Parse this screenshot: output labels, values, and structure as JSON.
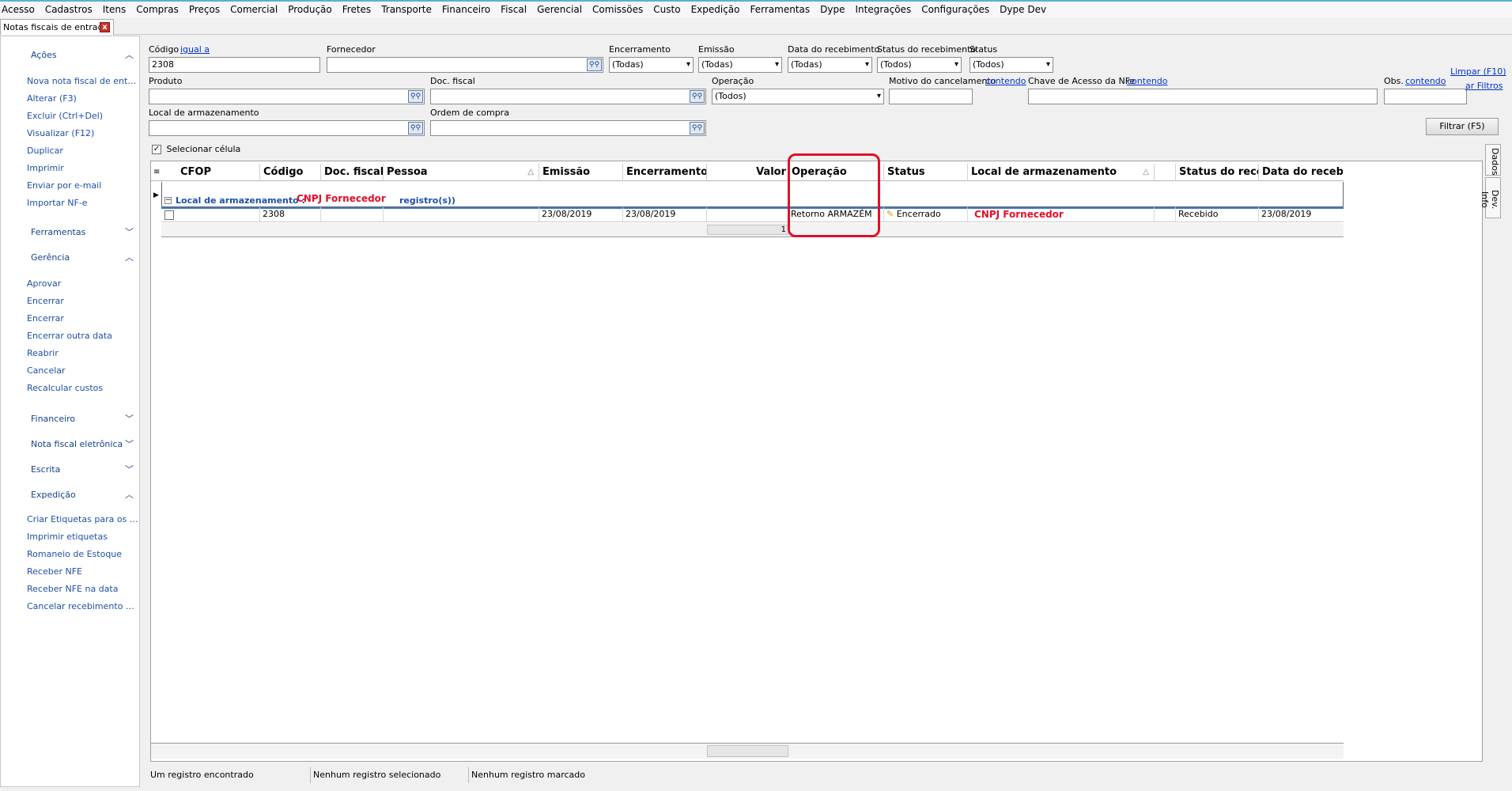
{
  "menu": [
    "Acesso",
    "Cadastros",
    "Itens",
    "Compras",
    "Preços",
    "Comercial",
    "Produção",
    "Fretes",
    "Transporte",
    "Financeiro",
    "Fiscal",
    "Gerencial",
    "Comissões",
    "Custo",
    "Expedição",
    "Ferramentas",
    "Dype",
    "Integrações",
    "Configurações",
    "Dype Dev"
  ],
  "doc_tab": {
    "label": "Notas fiscais de entrada",
    "close": "x"
  },
  "sidebar": {
    "acoes": {
      "title": "Ações",
      "items": [
        "Nova nota fiscal de entrada",
        "Alterar (F3)",
        "Excluir (Ctrl+Del)",
        "Visualizar (F12)",
        "Duplicar",
        "Imprimir",
        "Enviar por e-mail",
        "Importar NF-e"
      ]
    },
    "ferramentas": {
      "title": "Ferramentas"
    },
    "gerencia": {
      "title": "Gerência",
      "items": [
        "Aprovar",
        "Encerrar",
        "Encerrar",
        "Encerrar outra data",
        "Reabrir",
        "Cancelar",
        "Recalcular custos"
      ]
    },
    "financeiro": {
      "title": "Financeiro"
    },
    "nfe": {
      "title": "Nota fiscal eletrônica"
    },
    "escrita": {
      "title": "Escrita"
    },
    "expedicao": {
      "title": "Expedição",
      "items": [
        "Criar Etiquetas para os itens",
        "Imprimir etiquetas",
        "Romaneio de Estoque",
        "Receber NFE",
        "Receber NFE na data",
        "Cancelar recebimento NFE"
      ]
    }
  },
  "filters": {
    "codigo": {
      "label": "Código",
      "mode": "igual a",
      "value": "2308"
    },
    "fornecedor": {
      "label": "Fornecedor",
      "value": ""
    },
    "encerramento": {
      "label": "Encerramento",
      "value": "(Todas)"
    },
    "emissao": {
      "label": "Emissão",
      "value": "(Todas)"
    },
    "data_recebimento": {
      "label": "Data do recebimento",
      "value": "(Todas)"
    },
    "status_recebimento": {
      "label": "Status do recebimento",
      "value": "(Todos)"
    },
    "status": {
      "label": "Status",
      "value": "(Todos)"
    },
    "produto": {
      "label": "Produto",
      "value": ""
    },
    "doc_fiscal": {
      "label": "Doc. fiscal",
      "value": ""
    },
    "operacao": {
      "label": "Operação",
      "value": "(Todos)"
    },
    "motivo_cancelamento": {
      "label": "Motivo do cancelamento",
      "mode": "contendo",
      "value": ""
    },
    "chave_acesso": {
      "label": "Chave de Acesso da NFe",
      "mode": "contendo",
      "value": ""
    },
    "obs": {
      "label": "Obs.",
      "mode": "contendo",
      "value": ""
    },
    "local_armazenamento": {
      "label": "Local de armazenamento",
      "value": ""
    },
    "ordem_compra": {
      "label": "Ordem de compra",
      "value": ""
    }
  },
  "links": {
    "limpar": "Limpar (F10)",
    "filtros": "ar Filtros"
  },
  "filter_button": "Filtrar (F5)",
  "selecionar_celula": "Selecionar célula",
  "grid": {
    "columns": [
      "CFOP",
      "Código",
      "Doc. fiscal",
      "Pessoa",
      "Emissão",
      "Encerramento",
      "Valor",
      "Operação",
      "Status",
      "Local de armazenamento",
      "Status do recebimento",
      "Data do recebimento"
    ],
    "group": {
      "label": "Local de armazenamento :",
      "value": "CNPJ Fornecedor",
      "count": "registro(s))"
    },
    "row": {
      "cfop": "",
      "codigo": "2308",
      "doc_fiscal": "",
      "pessoa": "",
      "emissao": "23/08/2019",
      "encerramento": "23/08/2019",
      "valor": "",
      "operacao": "Retorno ARMAZÉM",
      "status": "Encerrado",
      "local": "CNPJ Fornecedor",
      "status_recebimento": "Recebido",
      "data_recebimento": "23/08/2019"
    },
    "summary_value": "1"
  },
  "right_tabs": [
    "Dados",
    "Dev. Info"
  ],
  "statusbar": [
    "Um registro encontrado",
    "Nenhum registro selecionado",
    "Nenhum registro marcado"
  ]
}
